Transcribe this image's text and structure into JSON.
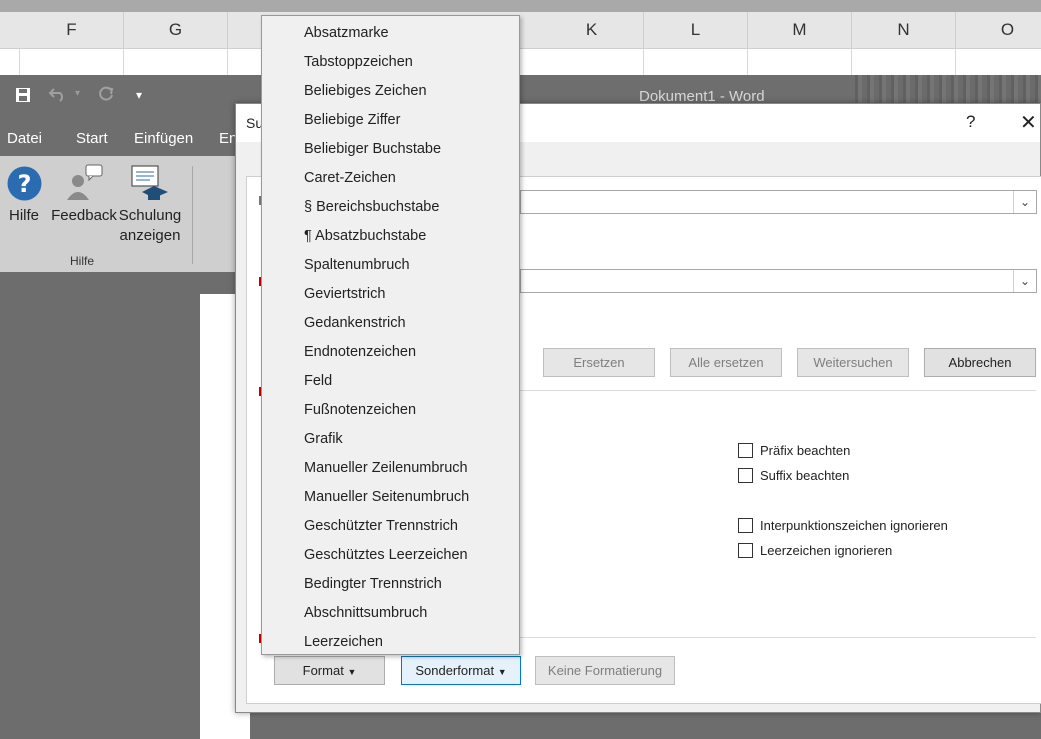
{
  "excel": {
    "columns": [
      "F",
      "G",
      "",
      "",
      "",
      "",
      "K",
      "L",
      "M",
      "N",
      "O"
    ]
  },
  "word": {
    "title": "Dokument1  -  Word",
    "quick_access": {
      "save_icon": "save-icon",
      "undo_icon": "undo-icon",
      "redo_icon": "redo-icon",
      "customize": "▾"
    },
    "tabs": [
      "Datei",
      "Start",
      "Einfügen",
      "En"
    ],
    "ribbon": {
      "help_label": "Hilfe",
      "feedback_label": "Feedback",
      "training_label_1": "Schulung",
      "training_label_2": "anzeigen",
      "group_label": "Hilfe"
    }
  },
  "dialog": {
    "title": "Su",
    "help": "?",
    "close": "✕",
    "buttons": {
      "replace": "Ersetzen",
      "replace_all": "Alle ersetzen",
      "find_next": "Weitersuchen",
      "cancel": "Abbrechen",
      "format": "Format",
      "special": "Sonderformat",
      "no_formatting": "Keine Formatierung"
    },
    "checkboxes": {
      "prefix": "Präfix beachten",
      "suffix": "Suffix beachten",
      "punctuation": "Interpunktionszeichen ignorieren",
      "whitespace": "Leerzeichen ignorieren"
    }
  },
  "menu": {
    "items": [
      "Absatzmarke",
      "Tabstoppzeichen",
      "Beliebiges Zeichen",
      "Beliebige Ziffer",
      "Beliebiger Buchstabe",
      "Caret-Zeichen",
      "§ Bereichsbuchstabe",
      "¶ Absatzbuchstabe",
      "Spaltenumbruch",
      "Geviertstrich",
      "Gedankenstrich",
      "Endnotenzeichen",
      "Feld",
      "Fußnotenzeichen",
      "Grafik",
      "Manueller Zeilenumbruch",
      "Manueller Seitenumbruch",
      "Geschützter Trennstrich",
      "Geschütztes Leerzeichen",
      "Bedingter Trennstrich",
      "Abschnittsumbruch",
      "Leerzeichen"
    ]
  }
}
